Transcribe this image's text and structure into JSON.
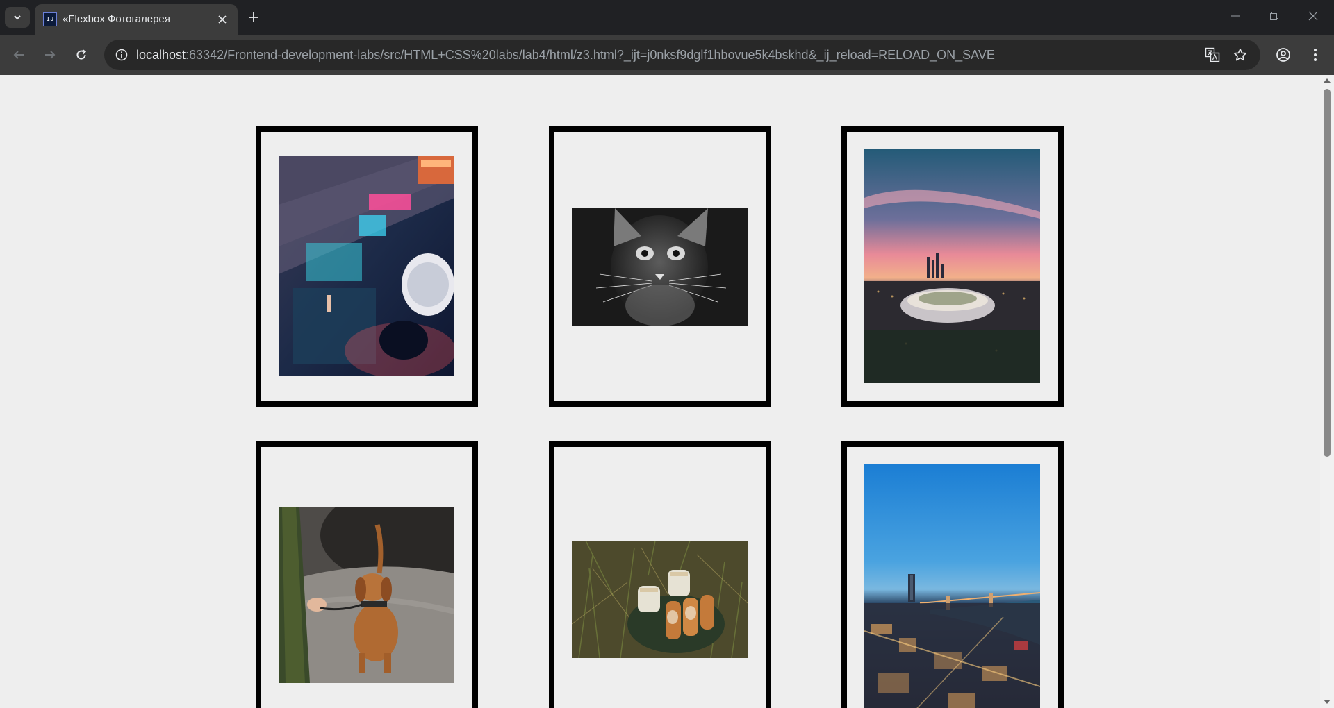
{
  "browser": {
    "tab": {
      "title": "«Flexbox Фотогалерея",
      "favicon": "intellij-icon",
      "favicon_text": "IJ"
    },
    "url": {
      "host": "localhost",
      "rest": ":63342/Frontend-development-labs/src/HTML+CSS%20labs/lab4/html/z3.html?_ijt=j0nksf9dglf1hbovue5k4bskhd&_ij_reload=RELOAD_ON_SAVE"
    }
  },
  "gallery": {
    "frame_color": "#000000",
    "background": "#eeeeee",
    "photos": [
      {
        "subject": "neon-city-street-photo"
      },
      {
        "subject": "black-white-cat-photo"
      },
      {
        "subject": "stadium-sunset-photo"
      },
      {
        "subject": "dachshund-on-rock-photo"
      },
      {
        "subject": "picnic-cups-bread-photo"
      },
      {
        "subject": "city-bridge-night-photo"
      }
    ]
  }
}
